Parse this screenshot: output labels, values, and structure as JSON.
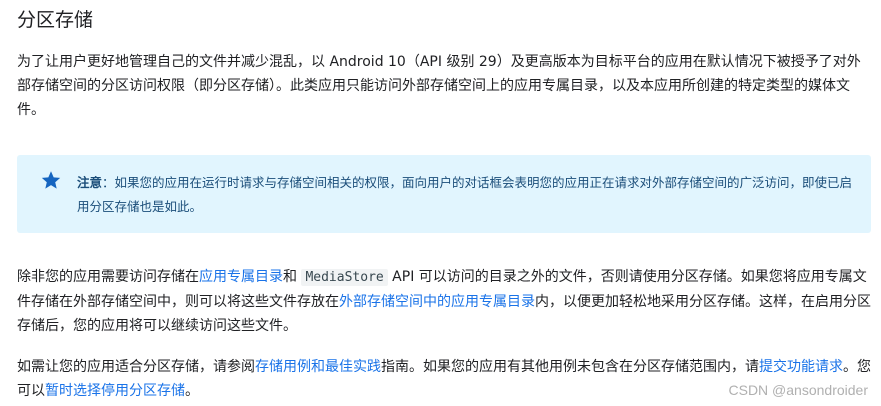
{
  "heading": "分区存储",
  "intro": {
    "text": "为了让用户更好地管理自己的文件并减少混乱，以 Android 10（API 级别 29）及更高版本为目标平台的应用在默认情况下被授予了对外部存储空间的分区访问权限（即分区存储）。此类应用只能访问外部存储空间上的应用专属目录，以及本应用所创建的特定类型的媒体文件。"
  },
  "note": {
    "icon": "star-icon",
    "icon_color": "#1565c0",
    "label": "注意",
    "colon": "：",
    "text": "如果您的应用在运行时请求与存储空间相关的权限，面向用户的对话框会表明您的应用正在请求对外部存储空间的广泛访问，即使已启用分区存储也是如此。",
    "background": "#e1f5fe"
  },
  "para2": {
    "t1": "除非您的应用需要访问存储在",
    "link1": "应用专属目录",
    "t2": "和 ",
    "code1": "MediaStore",
    "t3": " API 可以访问的目录之外的文件，否则请使用分区存储。如果您将应用专属文件存储在外部存储空间中，则可以将这些文件存放在",
    "link2": "外部存储空间中的应用专属目录",
    "t4": "内，以便更加轻松地采用分区存储。这样，在启用分区存储后，您的应用将可以继续访问这些文件。"
  },
  "para3": {
    "t1": "如需让您的应用适合分区存储，请参阅",
    "link1": "存储用例和最佳实践",
    "t2": "指南。如果您的应用有其他用例未包含在分区存储范围内，请",
    "link2": "提交功能请求",
    "t3": "。您可以",
    "link3": "暂时选择停用分区存储",
    "t4": "。"
  },
  "link_color": "#1a73e8",
  "watermark": "CSDN @ansondroider"
}
